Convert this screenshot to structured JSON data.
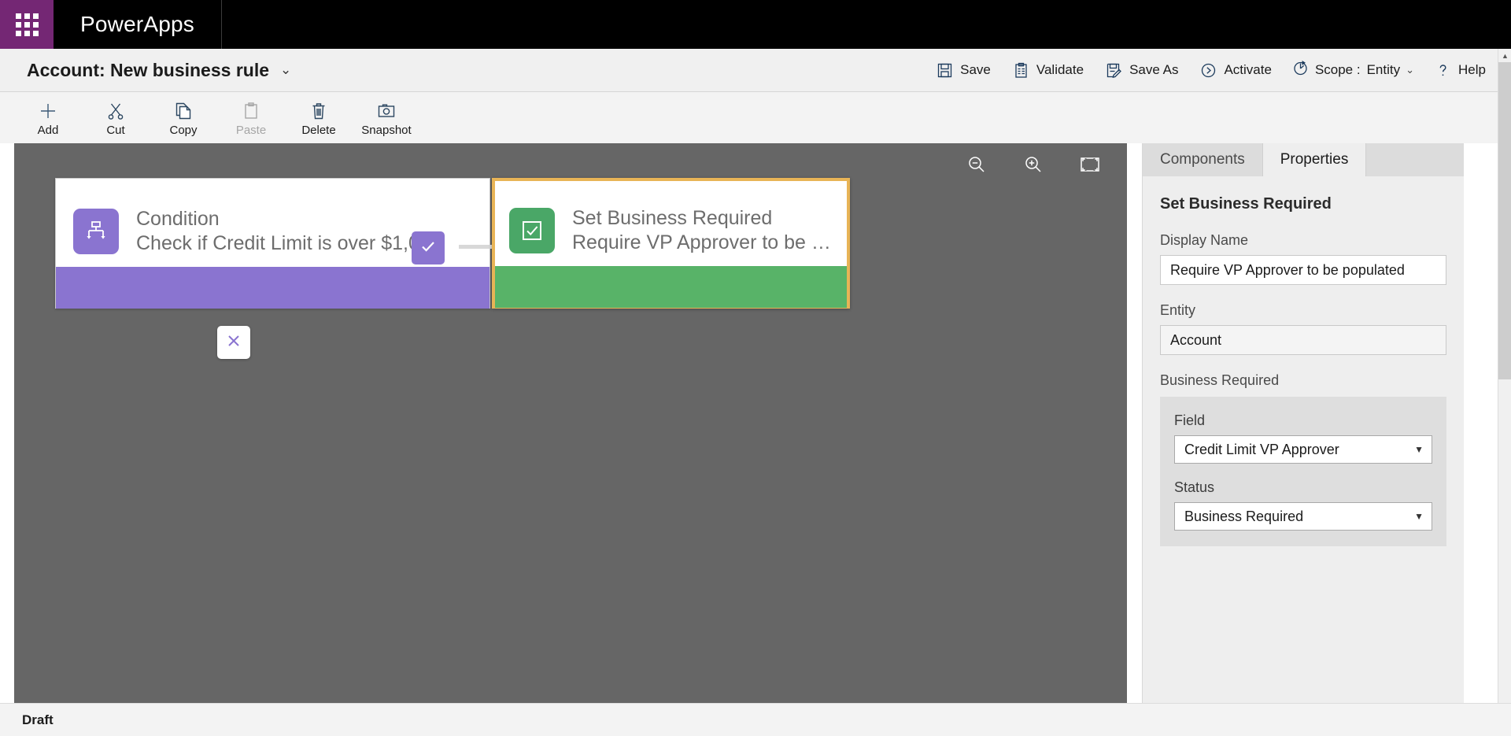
{
  "suite": {
    "waffle_icon": "app-launcher-icon",
    "brand": "PowerApps"
  },
  "commandbar": {
    "title": "Account: New business rule",
    "title_chevron": "⌄",
    "buttons": [
      {
        "label": "Save",
        "icon": "save-icon"
      },
      {
        "label": "Validate",
        "icon": "clipboard-check-icon"
      },
      {
        "label": "Save As",
        "icon": "save-as-icon"
      },
      {
        "label": "Activate",
        "icon": "play-circle-icon"
      }
    ],
    "scope": {
      "icon": "scope-icon",
      "label": "Scope :",
      "value": "Entity",
      "chevron": "⌄"
    },
    "help": {
      "icon": "question-icon",
      "label": "Help"
    }
  },
  "toolbar": {
    "items": [
      {
        "label": "Add",
        "icon": "plus-icon",
        "disabled": false
      },
      {
        "label": "Cut",
        "icon": "scissors-icon",
        "disabled": false
      },
      {
        "label": "Copy",
        "icon": "copy-icon",
        "disabled": false
      },
      {
        "label": "Paste",
        "icon": "clipboard-icon",
        "disabled": true
      },
      {
        "label": "Delete",
        "icon": "trash-icon",
        "disabled": false
      },
      {
        "label": "Snapshot",
        "icon": "camera-icon",
        "disabled": false
      }
    ]
  },
  "canvas": {
    "background_color": "#666666",
    "tools": [
      {
        "name": "zoom-out-icon"
      },
      {
        "name": "zoom-in-icon"
      },
      {
        "name": "fit-to-screen-icon"
      }
    ],
    "nodes": {
      "condition": {
        "icon": "condition-branch-icon",
        "title": "Condition",
        "subtitle": "Check if Credit Limit is over $1,0...",
        "accent_color": "#8a74d0"
      },
      "action": {
        "icon": "checkbox-icon",
        "title": "Set Business Required",
        "subtitle": "Require VP Approver to be pop...",
        "accent_color": "#58b368",
        "selected_border_color": "#e8b456"
      }
    },
    "connectors": {
      "true_badge": "check-icon",
      "false_badge": "close-icon"
    }
  },
  "pane": {
    "tabs": [
      {
        "label": "Components",
        "active": false
      },
      {
        "label": "Properties",
        "active": true
      }
    ],
    "heading": "Set Business Required",
    "display_name": {
      "label": "Display Name",
      "value": "Require VP Approver to be populated"
    },
    "entity": {
      "label": "Entity",
      "value": "Account"
    },
    "business_required": {
      "label": "Business Required",
      "field": {
        "label": "Field",
        "value": "Credit Limit VP Approver",
        "caret": "▼"
      },
      "status": {
        "label": "Status",
        "value": "Business Required",
        "caret": "▼"
      }
    }
  },
  "scrollbar": {
    "up": "▲",
    "down": "▼"
  },
  "statusbar": {
    "state": "Draft"
  }
}
